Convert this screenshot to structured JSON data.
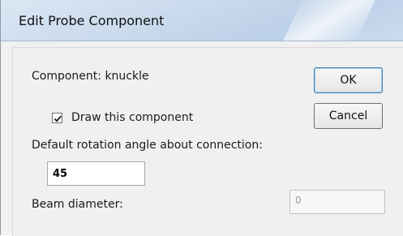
{
  "dialog": {
    "title": "Edit Probe Component",
    "component_label": "Component: knuckle",
    "draw_checkbox": {
      "label": "Draw this component",
      "checked": true
    },
    "rotation_label": "Default rotation angle about connection:",
    "rotation_value": "45",
    "beam_label": "Beam diameter:",
    "beam_value": "0",
    "beam_disabled": true,
    "ok_label": "OK",
    "cancel_label": "Cancel"
  },
  "icons": {
    "checkmark": "check-icon"
  }
}
